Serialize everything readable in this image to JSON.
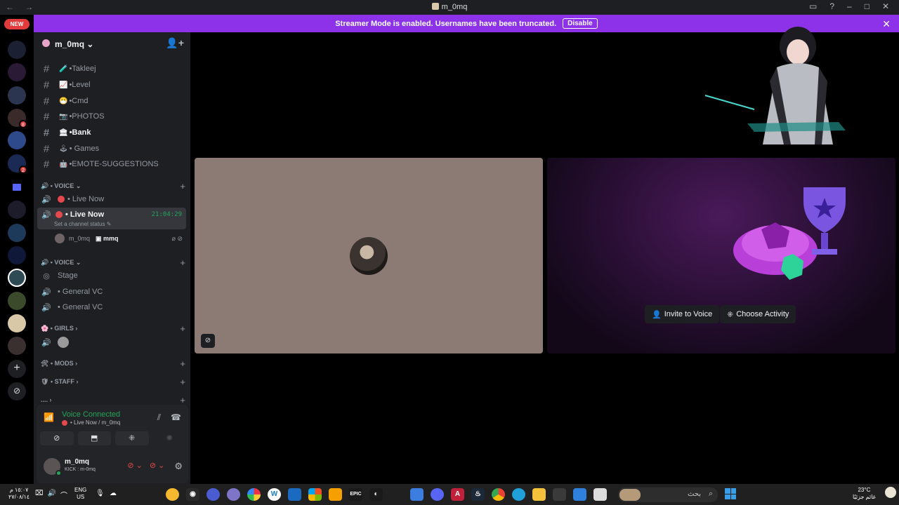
{
  "window": {
    "title": "m_0mq"
  },
  "banner": {
    "text": "Streamer Mode is enabled. Usernames have been truncated.",
    "disable_label": "Disable"
  },
  "servers": {
    "new_badge": "NEW",
    "badge_counts": [
      "8",
      "2"
    ]
  },
  "sidebar": {
    "server_name": "m_0mq",
    "text_channels": [
      {
        "emoji": "🧪",
        "name": "•Takleej",
        "bold": false
      },
      {
        "emoji": "📈",
        "name": "•Level",
        "bold": false
      },
      {
        "emoji": "😷",
        "name": "•Cmd",
        "bold": false
      },
      {
        "emoji": "📷",
        "name": "•PHOTOS",
        "bold": false
      },
      {
        "emoji": "🏛",
        "name": "•Bank",
        "bold": true
      },
      {
        "emoji": "🕹",
        "name": "• Games",
        "bold": false
      },
      {
        "emoji": "🤖",
        "name": "•EMOTE-SUGGESTIONS",
        "bold": false
      }
    ],
    "categories": {
      "voice1": "• VOICE",
      "voice2": "• VOICE",
      "girls": "• GIRLS",
      "mods": "• MODS",
      "staff": "• STAFF",
      "more": "...."
    },
    "voice_channels": {
      "live_now_1": "• Live Now",
      "live_now_2": "• Live Now",
      "live_time": "21:04:29",
      "status_hint": "Set a channel status",
      "member_name": "m_0mq",
      "member_tag": "mmq",
      "stage": "Stage",
      "general1": "• General VC",
      "general2": "• General VC"
    }
  },
  "voice_panel": {
    "title": "Voice Connected",
    "subtitle": "• Live Now / m_0mq"
  },
  "user": {
    "name": "m_0mq",
    "status": "KICK : m-0mq"
  },
  "activity": {
    "invite_label": "Invite to Voice",
    "choose_label": "Choose Activity"
  },
  "taskbar": {
    "clock_time": "١٥:٠٧ م",
    "clock_date": "٢٧/٠٨/١٤",
    "lang_top": "ENG",
    "lang_bottom": "US",
    "search_placeholder": "بحث",
    "weather_temp": "23°C",
    "weather_desc": "غائم جزئيًا"
  }
}
